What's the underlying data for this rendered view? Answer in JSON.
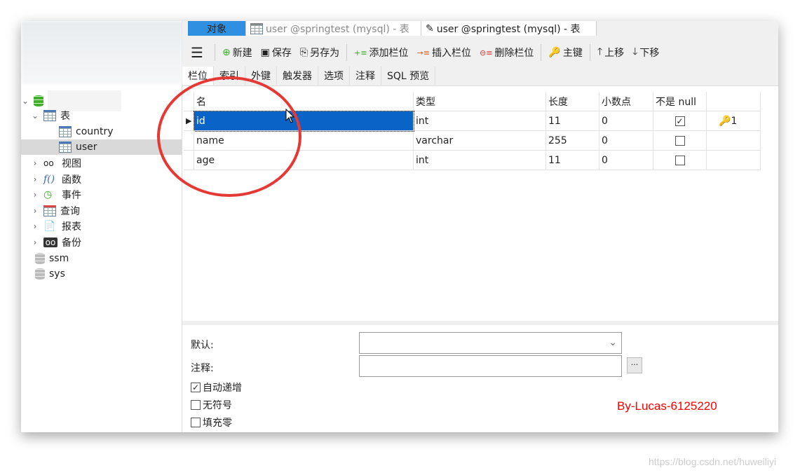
{
  "tabs": [
    {
      "label": "对象"
    },
    {
      "label": "user @springtest (mysql) - 表"
    },
    {
      "label": "user @springtest (mysql) - 表"
    }
  ],
  "toolbar": {
    "new": "新建",
    "save": "保存",
    "save_as": "另存为",
    "add_field": "添加栏位",
    "insert_field": "插入栏位",
    "delete_field": "删除栏位",
    "primary_key": "主键",
    "move_up": "上移",
    "move_down": "下移"
  },
  "subtabs": [
    "栏位",
    "索引",
    "外键",
    "触发器",
    "选项",
    "注释",
    "SQL 预览"
  ],
  "sidebar": {
    "tables_label": "表",
    "tables": [
      "country",
      "user"
    ],
    "groups": [
      "视图",
      "函数",
      "事件",
      "查询",
      "报表",
      "备份"
    ],
    "databases": [
      "ssm",
      "sys"
    ]
  },
  "grid": {
    "headers": [
      "名",
      "类型",
      "长度",
      "小数点",
      "不是 null",
      ""
    ],
    "rows": [
      {
        "name": "id",
        "type": "int",
        "length": "11",
        "decimals": "0",
        "not_null": true,
        "key": "1"
      },
      {
        "name": "name",
        "type": "varchar",
        "length": "255",
        "decimals": "0",
        "not_null": false,
        "key": ""
      },
      {
        "name": "age",
        "type": "int",
        "length": "11",
        "decimals": "0",
        "not_null": false,
        "key": ""
      }
    ]
  },
  "props": {
    "default_label": "默认:",
    "default_value": "",
    "comment_label": "注释:",
    "comment_value": "",
    "ellipsis": "...",
    "auto_increment": "自动递增",
    "auto_increment_checked": true,
    "unsigned": "无符号",
    "unsigned_checked": false,
    "zerofill": "填充零",
    "zerofill_checked": false
  },
  "watermark": "By-Lucas-6125220",
  "url_watermark": "https://blog.csdn.net/huweiliyi",
  "colors": {
    "accent": "#2f8fe0",
    "selection": "#0a64c8",
    "annotation": "#e53935",
    "watermark": "#ff0000"
  }
}
